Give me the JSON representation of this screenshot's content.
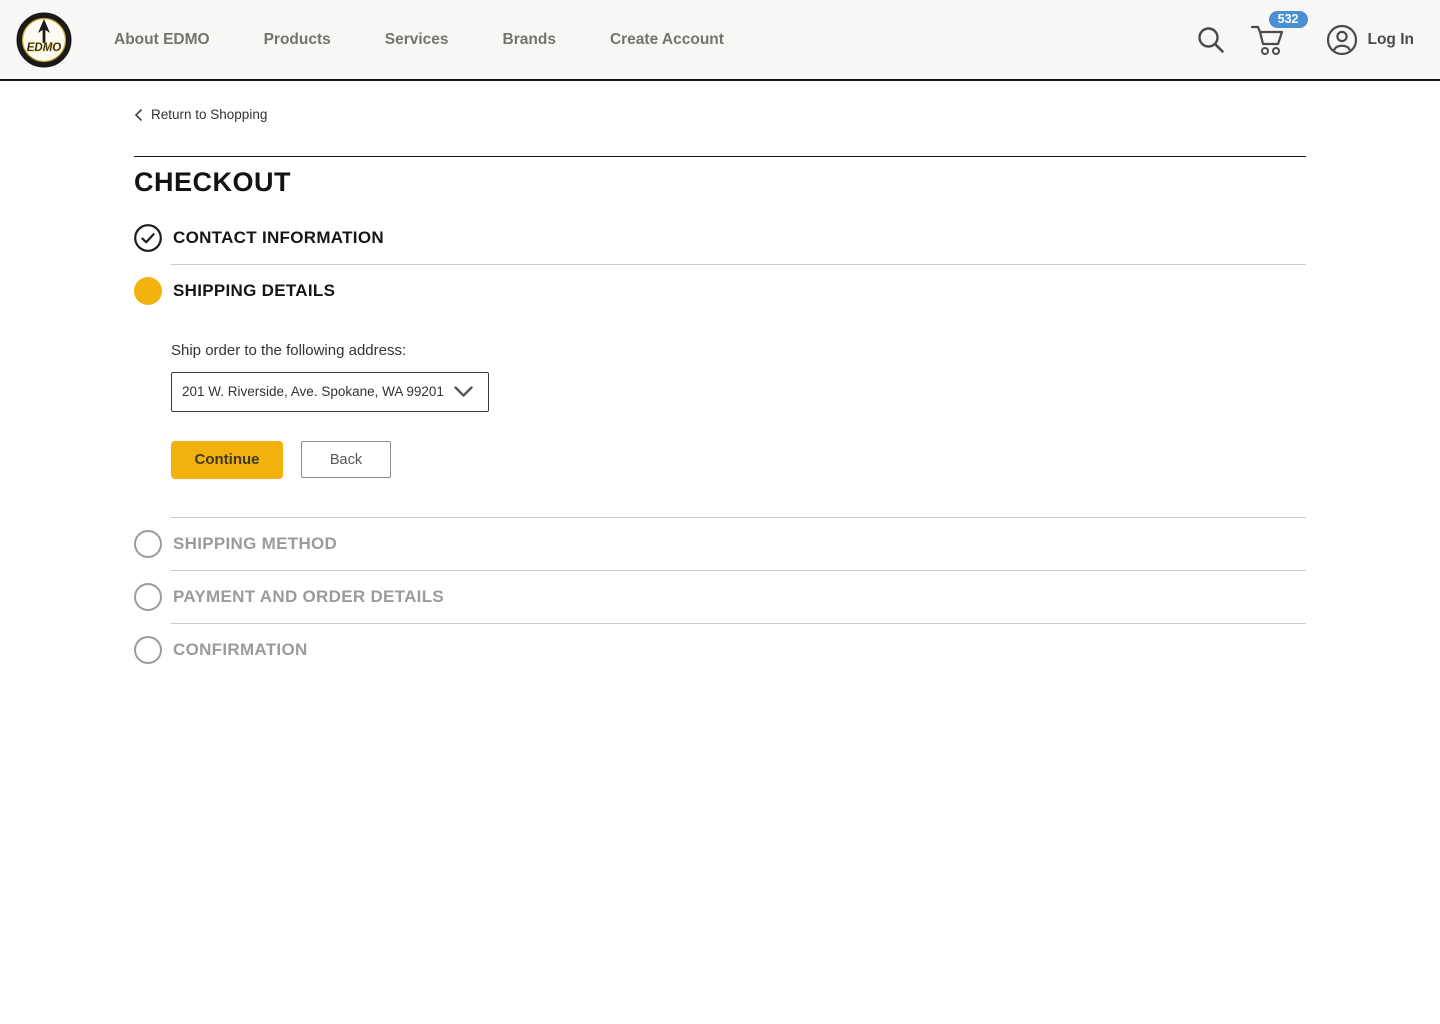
{
  "header": {
    "logo_text": "EDMO",
    "nav": [
      "About EDMO",
      "Products",
      "Services",
      "Brands",
      "Create Account"
    ],
    "cart_count": "532",
    "login_label": "Log In"
  },
  "page": {
    "return_link": "Return to Shopping",
    "title": "CHECKOUT"
  },
  "steps": {
    "contact": {
      "label": "CONTACT INFORMATION",
      "state": "complete"
    },
    "shipping": {
      "label": "SHIPPING DETAILS",
      "state": "active",
      "address_label": "Ship order to the following address:",
      "address_value": "201 W. Riverside, Ave. Spokane, WA 99201",
      "continue_label": "Continue",
      "back_label": "Back"
    },
    "shipping_method": {
      "label": "SHIPPING METHOD",
      "state": "pending"
    },
    "payment": {
      "label": "PAYMENT AND ORDER DETAILS",
      "state": "pending"
    },
    "confirmation": {
      "label": "CONFIRMATION",
      "state": "pending"
    }
  },
  "colors": {
    "accent_yellow": "#f3b10d",
    "badge_blue": "#4a8fd3",
    "header_bg": "#f7f7f6"
  }
}
